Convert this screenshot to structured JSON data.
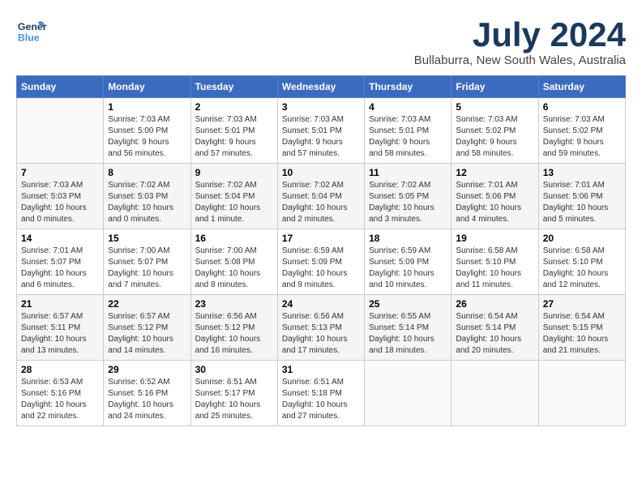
{
  "header": {
    "logo_general": "General",
    "logo_blue": "Blue",
    "month_title": "July 2024",
    "location": "Bullaburra, New South Wales, Australia"
  },
  "days_of_week": [
    "Sunday",
    "Monday",
    "Tuesday",
    "Wednesday",
    "Thursday",
    "Friday",
    "Saturday"
  ],
  "weeks": [
    [
      {
        "day": "",
        "info": ""
      },
      {
        "day": "1",
        "info": "Sunrise: 7:03 AM\nSunset: 5:00 PM\nDaylight: 9 hours\nand 56 minutes."
      },
      {
        "day": "2",
        "info": "Sunrise: 7:03 AM\nSunset: 5:01 PM\nDaylight: 9 hours\nand 57 minutes."
      },
      {
        "day": "3",
        "info": "Sunrise: 7:03 AM\nSunset: 5:01 PM\nDaylight: 9 hours\nand 57 minutes."
      },
      {
        "day": "4",
        "info": "Sunrise: 7:03 AM\nSunset: 5:01 PM\nDaylight: 9 hours\nand 58 minutes."
      },
      {
        "day": "5",
        "info": "Sunrise: 7:03 AM\nSunset: 5:02 PM\nDaylight: 9 hours\nand 58 minutes."
      },
      {
        "day": "6",
        "info": "Sunrise: 7:03 AM\nSunset: 5:02 PM\nDaylight: 9 hours\nand 59 minutes."
      }
    ],
    [
      {
        "day": "7",
        "info": "Sunrise: 7:03 AM\nSunset: 5:03 PM\nDaylight: 10 hours\nand 0 minutes."
      },
      {
        "day": "8",
        "info": "Sunrise: 7:02 AM\nSunset: 5:03 PM\nDaylight: 10 hours\nand 0 minutes."
      },
      {
        "day": "9",
        "info": "Sunrise: 7:02 AM\nSunset: 5:04 PM\nDaylight: 10 hours\nand 1 minute."
      },
      {
        "day": "10",
        "info": "Sunrise: 7:02 AM\nSunset: 5:04 PM\nDaylight: 10 hours\nand 2 minutes."
      },
      {
        "day": "11",
        "info": "Sunrise: 7:02 AM\nSunset: 5:05 PM\nDaylight: 10 hours\nand 3 minutes."
      },
      {
        "day": "12",
        "info": "Sunrise: 7:01 AM\nSunset: 5:06 PM\nDaylight: 10 hours\nand 4 minutes."
      },
      {
        "day": "13",
        "info": "Sunrise: 7:01 AM\nSunset: 5:06 PM\nDaylight: 10 hours\nand 5 minutes."
      }
    ],
    [
      {
        "day": "14",
        "info": "Sunrise: 7:01 AM\nSunset: 5:07 PM\nDaylight: 10 hours\nand 6 minutes."
      },
      {
        "day": "15",
        "info": "Sunrise: 7:00 AM\nSunset: 5:07 PM\nDaylight: 10 hours\nand 7 minutes."
      },
      {
        "day": "16",
        "info": "Sunrise: 7:00 AM\nSunset: 5:08 PM\nDaylight: 10 hours\nand 8 minutes."
      },
      {
        "day": "17",
        "info": "Sunrise: 6:59 AM\nSunset: 5:09 PM\nDaylight: 10 hours\nand 9 minutes."
      },
      {
        "day": "18",
        "info": "Sunrise: 6:59 AM\nSunset: 5:09 PM\nDaylight: 10 hours\nand 10 minutes."
      },
      {
        "day": "19",
        "info": "Sunrise: 6:58 AM\nSunset: 5:10 PM\nDaylight: 10 hours\nand 11 minutes."
      },
      {
        "day": "20",
        "info": "Sunrise: 6:58 AM\nSunset: 5:10 PM\nDaylight: 10 hours\nand 12 minutes."
      }
    ],
    [
      {
        "day": "21",
        "info": "Sunrise: 6:57 AM\nSunset: 5:11 PM\nDaylight: 10 hours\nand 13 minutes."
      },
      {
        "day": "22",
        "info": "Sunrise: 6:57 AM\nSunset: 5:12 PM\nDaylight: 10 hours\nand 14 minutes."
      },
      {
        "day": "23",
        "info": "Sunrise: 6:56 AM\nSunset: 5:12 PM\nDaylight: 10 hours\nand 16 minutes."
      },
      {
        "day": "24",
        "info": "Sunrise: 6:56 AM\nSunset: 5:13 PM\nDaylight: 10 hours\nand 17 minutes."
      },
      {
        "day": "25",
        "info": "Sunrise: 6:55 AM\nSunset: 5:14 PM\nDaylight: 10 hours\nand 18 minutes."
      },
      {
        "day": "26",
        "info": "Sunrise: 6:54 AM\nSunset: 5:14 PM\nDaylight: 10 hours\nand 20 minutes."
      },
      {
        "day": "27",
        "info": "Sunrise: 6:54 AM\nSunset: 5:15 PM\nDaylight: 10 hours\nand 21 minutes."
      }
    ],
    [
      {
        "day": "28",
        "info": "Sunrise: 6:53 AM\nSunset: 5:16 PM\nDaylight: 10 hours\nand 22 minutes."
      },
      {
        "day": "29",
        "info": "Sunrise: 6:52 AM\nSunset: 5:16 PM\nDaylight: 10 hours\nand 24 minutes."
      },
      {
        "day": "30",
        "info": "Sunrise: 6:51 AM\nSunset: 5:17 PM\nDaylight: 10 hours\nand 25 minutes."
      },
      {
        "day": "31",
        "info": "Sunrise: 6:51 AM\nSunset: 5:18 PM\nDaylight: 10 hours\nand 27 minutes."
      },
      {
        "day": "",
        "info": ""
      },
      {
        "day": "",
        "info": ""
      },
      {
        "day": "",
        "info": ""
      }
    ]
  ]
}
